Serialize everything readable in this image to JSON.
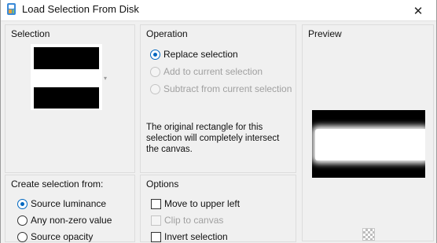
{
  "window": {
    "title": "Load Selection From Disk",
    "close_glyph": "✕",
    "app_icon": "paintshop-icon"
  },
  "selection": {
    "label": "Selection"
  },
  "operation": {
    "label": "Operation",
    "options": [
      {
        "label": "Replace selection",
        "checked": true,
        "enabled": true
      },
      {
        "label": "Add to current selection",
        "checked": false,
        "enabled": false
      },
      {
        "label": "Subtract from current selection",
        "checked": false,
        "enabled": false
      }
    ],
    "info": "The original rectangle for this selection will completely intersect the canvas."
  },
  "preview": {
    "label": "Preview"
  },
  "create": {
    "label": "Create selection from:",
    "options": [
      {
        "label": "Source luminance",
        "checked": true
      },
      {
        "label": "Any non-zero value",
        "checked": false
      },
      {
        "label": "Source opacity",
        "checked": false
      }
    ]
  },
  "options": {
    "label": "Options",
    "items": [
      {
        "label": "Move to upper left",
        "checked": false,
        "enabled": true
      },
      {
        "label": "Clip to canvas",
        "checked": false,
        "enabled": false
      },
      {
        "label": "Invert selection",
        "checked": false,
        "enabled": true
      }
    ]
  },
  "colors": {
    "accent": "#0067c0",
    "disabled_text": "#a0a0a0"
  }
}
